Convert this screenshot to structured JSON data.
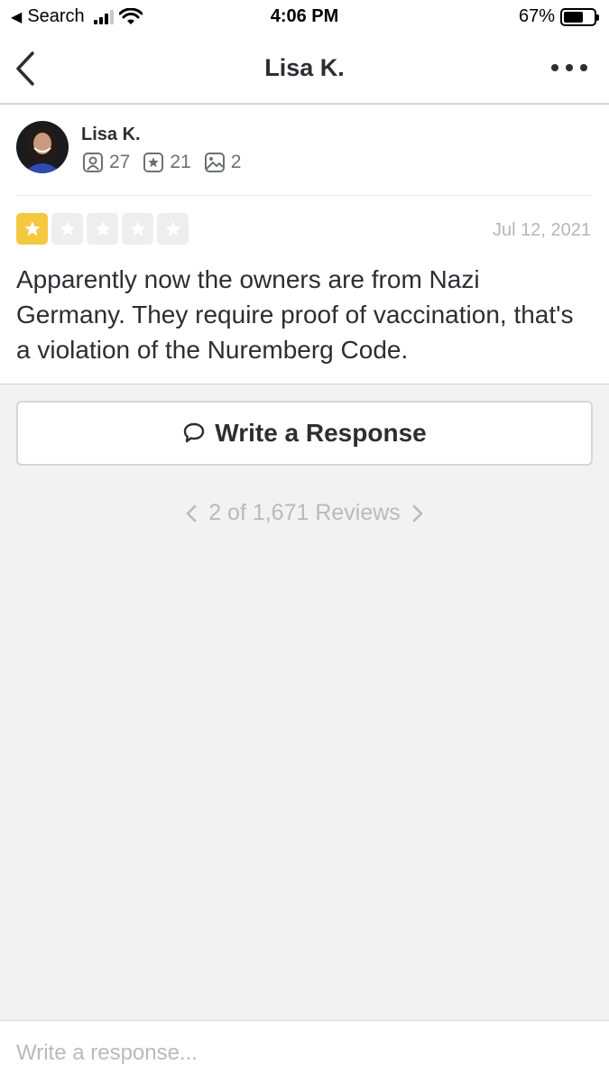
{
  "status_bar": {
    "back_app": "Search",
    "time": "4:06 PM",
    "battery_percent": "67%"
  },
  "nav": {
    "title": "Lisa K."
  },
  "review": {
    "user": {
      "name": "Lisa K.",
      "friends_count": "27",
      "reviews_count": "21",
      "photos_count": "2"
    },
    "rating": 1,
    "rating_max": 5,
    "date": "Jul 12, 2021",
    "text": "Apparently now the owners are from Nazi Germany. They require proof of vaccination, that's a violation of the Nuremberg Code."
  },
  "write_response_label": "Write a Response",
  "pager": {
    "label": "2 of 1,671 Reviews"
  },
  "bottom": {
    "placeholder": "Write a response..."
  },
  "colors": {
    "star_filled": "#f5c842",
    "star_empty": "#eeeeef",
    "text_primary": "#2d2e33",
    "text_muted": "#b8babd"
  }
}
